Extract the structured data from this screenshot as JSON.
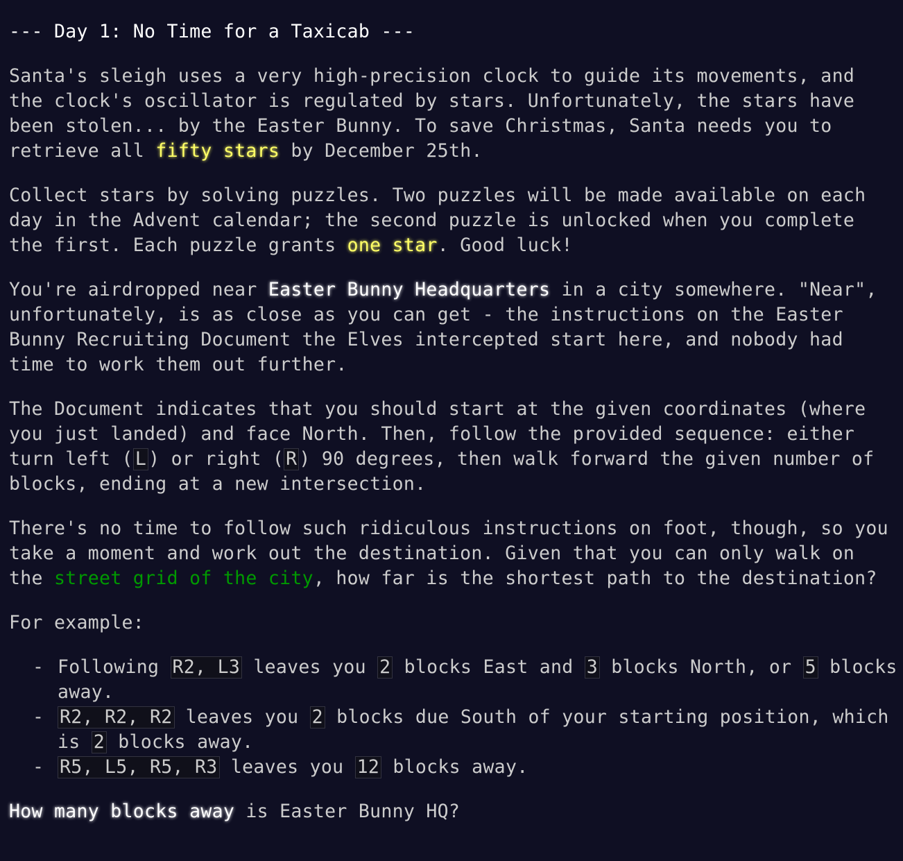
{
  "title": "--- Day 1: No Time for a Taxicab ---",
  "p1": {
    "a": "Santa's sleigh uses a very high-precision clock to guide its movements, and the clock's oscillator is regulated by stars. Unfortunately, the stars have been stolen... by the Easter Bunny. To save Christmas, Santa needs you to retrieve all ",
    "star": "fifty stars",
    "b": " by December 25th."
  },
  "p2": {
    "a": "Collect stars by solving puzzles. Two puzzles will be made available on each day in the Advent calendar; the second puzzle is unlocked when you complete the first. Each puzzle grants ",
    "star": "one star",
    "b": ". Good luck!"
  },
  "p3": {
    "a": "You're airdropped near ",
    "emph": "Easter Bunny Headquarters",
    "b": " in a city somewhere. \"Near\", unfortunately, is as close as you can get - the instructions on the Easter Bunny Recruiting Document the Elves intercepted start here, and nobody had time to work them out further."
  },
  "p4": {
    "a": "The Document indicates that you should start at the given coordinates (where you just landed) and face North. Then, follow the provided sequence: either turn left (",
    "code_l": "L",
    "b": ") or right (",
    "code_r": "R",
    "c": ") 90 degrees, then walk forward the given number of blocks, ending at a new intersection."
  },
  "p5": {
    "a": "There's no time to follow such ridiculous instructions on foot, though, so you take a moment and work out the destination. Given that you can only walk on the ",
    "link": "street grid of the city",
    "b": ", how far is the shortest path to the destination?"
  },
  "example_intro": "For example:",
  "examples": [
    {
      "bullet": "-",
      "t0": "Following ",
      "c0": "R2, L3",
      "t1": " leaves you ",
      "c1": "2",
      "t2": " blocks East and ",
      "c2": "3",
      "t3": " blocks North, or ",
      "c3": "5",
      "t4": " blocks away."
    },
    {
      "bullet": "-",
      "c0": "R2, R2, R2",
      "t1": " leaves you ",
      "c1": "2",
      "t2": " blocks due South of your starting position, which is ",
      "c2": "2",
      "t3": " blocks away."
    },
    {
      "bullet": "-",
      "c0": "R5, L5, R5, R3",
      "t1": " leaves you ",
      "c1": "12",
      "t2": " blocks away."
    }
  ],
  "question": {
    "emph": "How many blocks away",
    "rest": " is Easter Bunny HQ?"
  },
  "colors": {
    "background": "#0f0f23",
    "text": "#cccccc",
    "star": "#ffff66",
    "link": "#009900",
    "emphasis": "#ffffff"
  }
}
